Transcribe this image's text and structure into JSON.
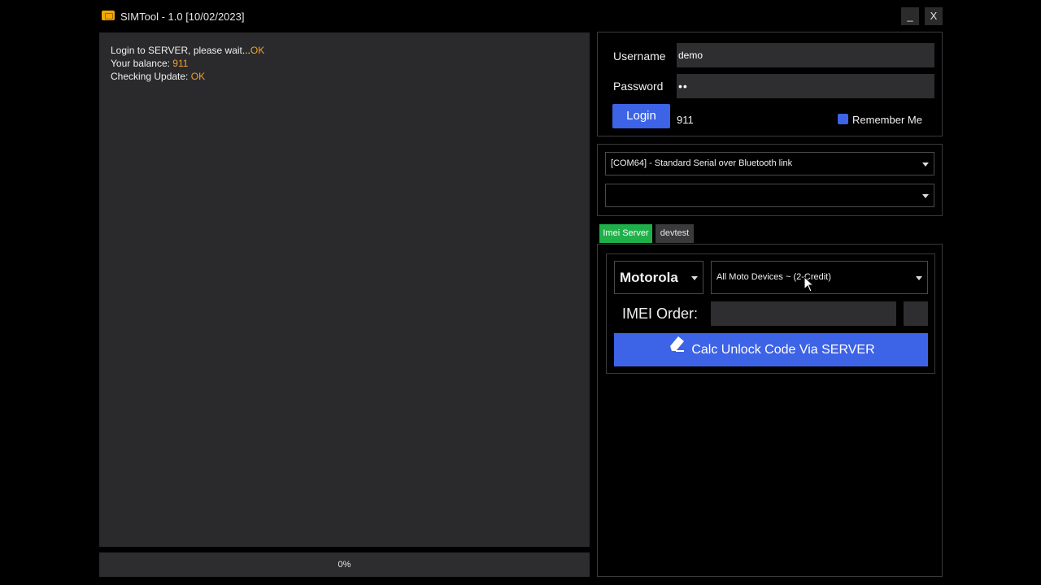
{
  "window": {
    "title": "SIMTool - 1.0 [10/02/2023]",
    "minimize_label": "_",
    "close_label": "X"
  },
  "log": [
    {
      "text": "Login to SERVER, please wait...",
      "status": "OK"
    },
    {
      "text": "Your balance: ",
      "status": "911"
    },
    {
      "text": "Checking Update: ",
      "status": "OK"
    }
  ],
  "progress": {
    "value": 0,
    "label": "0%"
  },
  "login": {
    "username_label": "Username",
    "username_value": "demo",
    "password_label": "Password",
    "password_value": "••",
    "login_button": "Login",
    "balance": "911",
    "remember_label": "Remember Me",
    "remember_checked": true
  },
  "connection": {
    "port_selected": "[COM64] - Standard Serial over Bluetooth link",
    "model_selected": ""
  },
  "tabs": [
    {
      "label": "Imei Server",
      "active": true
    },
    {
      "label": "devtest",
      "active": false
    }
  ],
  "imei_server": {
    "brand_selected": "Motorola",
    "service_selected": "All Moto Devices ~ (2-Credit)",
    "imei_label": "IMEI Order:",
    "imei_value": "",
    "calc_button": "Calc Unlock Code Via SERVER"
  },
  "colors": {
    "accent": "#3d63e6",
    "ok_status": "#f0a030",
    "tab_active": "#1fb04a",
    "panel": "#2a2a2c"
  }
}
